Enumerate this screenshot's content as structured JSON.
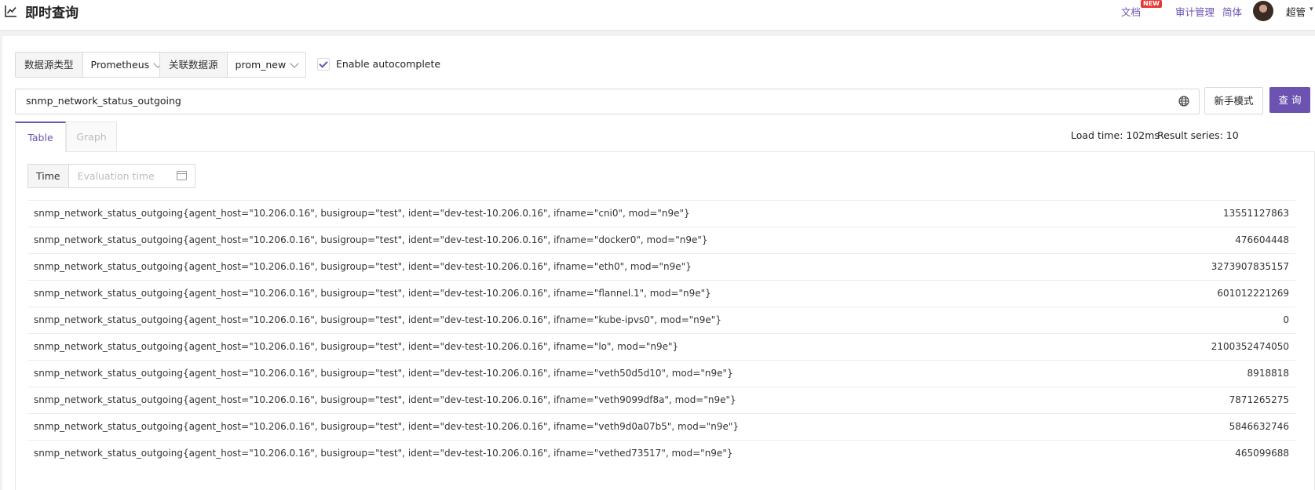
{
  "header": {
    "title": "即时查询",
    "nav": {
      "docs": "文档",
      "docs_badge": "NEW",
      "audit": "审计管理",
      "lang": "简体"
    },
    "user": "超管"
  },
  "toolbar": {
    "datasource_type_label": "数据源类型",
    "datasource_type_value": "Prometheus",
    "datasource_label": "关联数据源",
    "datasource_value": "prom_new",
    "autocomplete_label": "Enable autocomplete",
    "autocomplete_checked": true
  },
  "query": {
    "expression": "snmp_network_status_outgoing",
    "novice_button": "新手模式",
    "query_button": "查 询"
  },
  "tabs": {
    "table": "Table",
    "graph": "Graph",
    "active": "Table"
  },
  "stats": {
    "load_time": "Load time: 102ms",
    "result_series": "Result series: 10"
  },
  "time_filter": {
    "label": "Time",
    "placeholder": "Evaluation time"
  },
  "results": [
    {
      "series": "snmp_network_status_outgoing{agent_host=\"10.206.0.16\", busigroup=\"test\", ident=\"dev-test-10.206.0.16\", ifname=\"cni0\", mod=\"n9e\"}",
      "value": "13551127863"
    },
    {
      "series": "snmp_network_status_outgoing{agent_host=\"10.206.0.16\", busigroup=\"test\", ident=\"dev-test-10.206.0.16\", ifname=\"docker0\", mod=\"n9e\"}",
      "value": "476604448"
    },
    {
      "series": "snmp_network_status_outgoing{agent_host=\"10.206.0.16\", busigroup=\"test\", ident=\"dev-test-10.206.0.16\", ifname=\"eth0\", mod=\"n9e\"}",
      "value": "3273907835157"
    },
    {
      "series": "snmp_network_status_outgoing{agent_host=\"10.206.0.16\", busigroup=\"test\", ident=\"dev-test-10.206.0.16\", ifname=\"flannel.1\", mod=\"n9e\"}",
      "value": "601012221269"
    },
    {
      "series": "snmp_network_status_outgoing{agent_host=\"10.206.0.16\", busigroup=\"test\", ident=\"dev-test-10.206.0.16\", ifname=\"kube-ipvs0\", mod=\"n9e\"}",
      "value": "0"
    },
    {
      "series": "snmp_network_status_outgoing{agent_host=\"10.206.0.16\", busigroup=\"test\", ident=\"dev-test-10.206.0.16\", ifname=\"lo\", mod=\"n9e\"}",
      "value": "2100352474050"
    },
    {
      "series": "snmp_network_status_outgoing{agent_host=\"10.206.0.16\", busigroup=\"test\", ident=\"dev-test-10.206.0.16\", ifname=\"veth50d5d10\", mod=\"n9e\"}",
      "value": "8918818"
    },
    {
      "series": "snmp_network_status_outgoing{agent_host=\"10.206.0.16\", busigroup=\"test\", ident=\"dev-test-10.206.0.16\", ifname=\"veth9099df8a\", mod=\"n9e\"}",
      "value": "7871265275"
    },
    {
      "series": "snmp_network_status_outgoing{agent_host=\"10.206.0.16\", busigroup=\"test\", ident=\"dev-test-10.206.0.16\", ifname=\"veth9d0a07b5\", mod=\"n9e\"}",
      "value": "5846632746"
    },
    {
      "series": "snmp_network_status_outgoing{agent_host=\"10.206.0.16\", busigroup=\"test\", ident=\"dev-test-10.206.0.16\", ifname=\"vethed73517\", mod=\"n9e\"}",
      "value": "465099688"
    }
  ],
  "colors": {
    "accent": "#6c53b1",
    "badge": "#e53935"
  },
  "icons": [
    "line-chart-icon",
    "globe-icon",
    "calendar-icon",
    "chevron-down-icon",
    "checkmark-icon"
  ]
}
